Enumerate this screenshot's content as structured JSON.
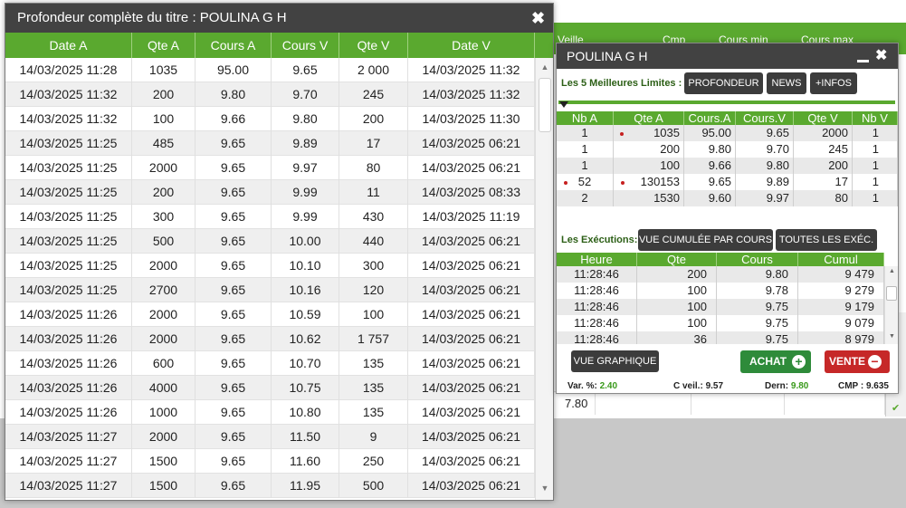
{
  "background": {
    "header_cols": [
      "Veille",
      "Cmp",
      "Cours min",
      "Cours max"
    ],
    "visible_row_value": "7.80"
  },
  "depth_window": {
    "title": "Profondeur complète du titre : POULINA G H",
    "columns": [
      "Date A",
      "Qte A",
      "Cours A",
      "Cours V",
      "Qte V",
      "Date V"
    ],
    "rows": [
      [
        "14/03/2025 11:28",
        "1035",
        "95.00",
        "9.65",
        "2 000",
        "14/03/2025 11:32"
      ],
      [
        "14/03/2025 11:32",
        "200",
        "9.80",
        "9.70",
        "245",
        "14/03/2025 11:32"
      ],
      [
        "14/03/2025 11:32",
        "100",
        "9.66",
        "9.80",
        "200",
        "14/03/2025 11:30"
      ],
      [
        "14/03/2025 11:25",
        "485",
        "9.65",
        "9.89",
        "17",
        "14/03/2025 06:21"
      ],
      [
        "14/03/2025 11:25",
        "2000",
        "9.65",
        "9.97",
        "80",
        "14/03/2025 06:21"
      ],
      [
        "14/03/2025 11:25",
        "200",
        "9.65",
        "9.99",
        "11",
        "14/03/2025 08:33"
      ],
      [
        "14/03/2025 11:25",
        "300",
        "9.65",
        "9.99",
        "430",
        "14/03/2025 11:19"
      ],
      [
        "14/03/2025 11:25",
        "500",
        "9.65",
        "10.00",
        "440",
        "14/03/2025 06:21"
      ],
      [
        "14/03/2025 11:25",
        "2000",
        "9.65",
        "10.10",
        "300",
        "14/03/2025 06:21"
      ],
      [
        "14/03/2025 11:25",
        "2700",
        "9.65",
        "10.16",
        "120",
        "14/03/2025 06:21"
      ],
      [
        "14/03/2025 11:26",
        "2000",
        "9.65",
        "10.59",
        "100",
        "14/03/2025 06:21"
      ],
      [
        "14/03/2025 11:26",
        "2000",
        "9.65",
        "10.62",
        "1 757",
        "14/03/2025 06:21"
      ],
      [
        "14/03/2025 11:26",
        "600",
        "9.65",
        "10.70",
        "135",
        "14/03/2025 06:21"
      ],
      [
        "14/03/2025 11:26",
        "4000",
        "9.65",
        "10.75",
        "135",
        "14/03/2025 06:21"
      ],
      [
        "14/03/2025 11:26",
        "1000",
        "9.65",
        "10.80",
        "135",
        "14/03/2025 06:21"
      ],
      [
        "14/03/2025 11:27",
        "2000",
        "9.65",
        "11.50",
        "9",
        "14/03/2025 06:21"
      ],
      [
        "14/03/2025 11:27",
        "1500",
        "9.65",
        "11.60",
        "250",
        "14/03/2025 06:21"
      ],
      [
        "14/03/2025 11:27",
        "1500",
        "9.65",
        "11.95",
        "500",
        "14/03/2025 06:21"
      ]
    ],
    "scroll_up": "▲",
    "scroll_down": "▼"
  },
  "quote_panel": {
    "title": "POULINA G H",
    "limits_label": "Les 5 Meilleures Limites :",
    "btn_profondeur": "PROFONDEUR",
    "btn_news": "NEWS",
    "btn_infos": "+INFOS",
    "limits_columns": [
      "Nb A",
      "Qte A",
      "Cours.A",
      "Cours.V",
      "Qte V",
      "Nb V"
    ],
    "limits_rows": [
      [
        "1",
        "1035",
        "95.00",
        "9.65",
        "2000",
        "1"
      ],
      [
        "1",
        "200",
        "9.80",
        "9.70",
        "245",
        "1"
      ],
      [
        "1",
        "100",
        "9.66",
        "9.80",
        "200",
        "1"
      ],
      [
        "52",
        "130153",
        "9.65",
        "9.89",
        "17",
        "1"
      ],
      [
        "2",
        "1530",
        "9.60",
        "9.97",
        "80",
        "1"
      ]
    ],
    "exec_label": "Les Exécutions:",
    "btn_vue_cumulee": "VUE CUMULÉE PAR COURS",
    "btn_toutes": "TOUTES LES EXÉC.",
    "exec_columns": [
      "Heure",
      "Qte",
      "Cours",
      "Cumul"
    ],
    "exec_rows": [
      [
        "11:28:46",
        "200",
        "9.80",
        "9 479"
      ],
      [
        "11:28:46",
        "100",
        "9.78",
        "9 279"
      ],
      [
        "11:28:46",
        "100",
        "9.75",
        "9 179"
      ],
      [
        "11:28:46",
        "100",
        "9.75",
        "9 079"
      ],
      [
        "11:28:46",
        "36",
        "9.75",
        "8 979"
      ]
    ],
    "btn_vue_graphique": "VUE GRAPHIQUE",
    "btn_achat": "ACHAT",
    "btn_vente": "VENTE",
    "stats": {
      "var_label": "Var. %:",
      "var_value": "2.40",
      "cveil_label": "C veil.:",
      "cveil_value": "9.57",
      "dern_label": "Dern:",
      "dern_value": "9.80",
      "cmp_label": "CMP :",
      "cmp_value": "9.635"
    },
    "colors": {
      "accent": "#5aa92f",
      "title_bar": "#424242",
      "achat": "#2e8b3a",
      "vente": "#c62828"
    }
  }
}
